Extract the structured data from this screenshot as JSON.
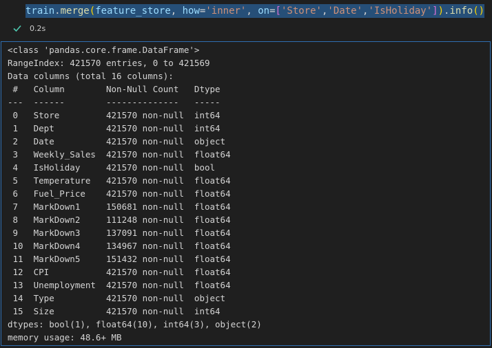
{
  "cell": {
    "code_tokens": [
      {
        "text": "train",
        "cls": "tk-var"
      },
      {
        "text": ".",
        "cls": "tk-punc"
      },
      {
        "text": "merge",
        "cls": "tk-fn"
      },
      {
        "text": "(",
        "cls": "tk-br2"
      },
      {
        "text": "feature_store",
        "cls": "tk-var"
      },
      {
        "text": ", ",
        "cls": "tk-punc"
      },
      {
        "text": "how",
        "cls": "tk-var"
      },
      {
        "text": "=",
        "cls": "tk-punc"
      },
      {
        "text": "'inner'",
        "cls": "tk-str"
      },
      {
        "text": ", ",
        "cls": "tk-punc"
      },
      {
        "text": "on",
        "cls": "tk-var"
      },
      {
        "text": "=",
        "cls": "tk-punc"
      },
      {
        "text": "[",
        "cls": "tk-br1"
      },
      {
        "text": "'Store'",
        "cls": "tk-str"
      },
      {
        "text": ",",
        "cls": "tk-punc"
      },
      {
        "text": "'Date'",
        "cls": "tk-str"
      },
      {
        "text": ",",
        "cls": "tk-punc"
      },
      {
        "text": "'IsHoliday'",
        "cls": "tk-str"
      },
      {
        "text": "]",
        "cls": "tk-br1"
      },
      {
        "text": ")",
        "cls": "tk-br2"
      },
      {
        "text": ".",
        "cls": "tk-punc"
      },
      {
        "text": "info",
        "cls": "tk-fn"
      },
      {
        "text": "()",
        "cls": "tk-br2"
      }
    ],
    "exec_time": "0.2s",
    "status_icon": "check-icon",
    "colors": {
      "check": "#4ec9b0",
      "selection": "#264f78",
      "output_border": "#2f6fb2"
    }
  },
  "output": {
    "lines": [
      "<class 'pandas.core.frame.DataFrame'>",
      "RangeIndex: 421570 entries, 0 to 421569",
      "Data columns (total 16 columns):",
      " #   Column        Non-Null Count   Dtype  ",
      "---  ------        --------------   -----  ",
      " 0   Store         421570 non-null  int64  ",
      " 1   Dept          421570 non-null  int64  ",
      " 2   Date          421570 non-null  object ",
      " 3   Weekly_Sales  421570 non-null  float64",
      " 4   IsHoliday     421570 non-null  bool   ",
      " 5   Temperature   421570 non-null  float64",
      " 6   Fuel_Price    421570 non-null  float64",
      " 7   MarkDown1     150681 non-null  float64",
      " 8   MarkDown2     111248 non-null  float64",
      " 9   MarkDown3     137091 non-null  float64",
      " 10  MarkDown4     134967 non-null  float64",
      " 11  MarkDown5     151432 non-null  float64",
      " 12  CPI           421570 non-null  float64",
      " 13  Unemployment  421570 non-null  float64",
      " 14  Type          421570 non-null  object ",
      " 15  Size          421570 non-null  int64  ",
      "dtypes: bool(1), float64(10), int64(3), object(2)",
      "memory usage: 48.6+ MB"
    ]
  }
}
